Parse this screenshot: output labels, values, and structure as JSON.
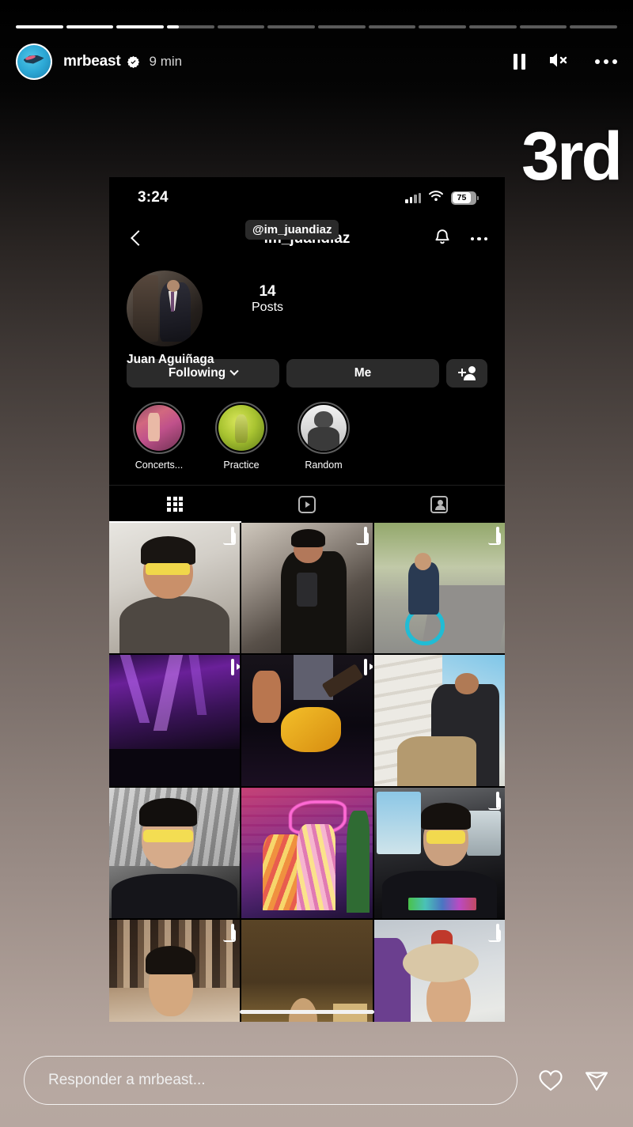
{
  "story": {
    "progress": {
      "total_segments": 12,
      "completed": 3,
      "current_fill_percent": 25
    },
    "header": {
      "username": "mrbeast",
      "verified_icon": "verified-badge-icon",
      "timestamp": "9 min",
      "pause_icon": "pause-icon",
      "mute_icon": "speaker-muted-icon",
      "more_icon": "more-options-icon"
    },
    "reply": {
      "placeholder": "Responder a mrbeast...",
      "like_icon": "heart-icon",
      "send_icon": "paper-plane-icon"
    }
  },
  "phone": {
    "status_bar": {
      "time": "3:24",
      "signal_icon": "cellular-signal-icon",
      "wifi_icon": "wifi-icon",
      "battery_level": "75"
    },
    "nav": {
      "back_icon": "back-chevron-icon",
      "title": "im_juandiaz",
      "notify_icon": "bell-icon",
      "more_icon": "more-options-icon"
    },
    "profile": {
      "display_name": "Juan Aguiñaga",
      "posts_count": "14",
      "posts_label": "Posts",
      "avatar_icon": "profile-avatar"
    },
    "buttons": {
      "following": "Following",
      "chevron_icon": "chevron-down-icon",
      "message": "Me",
      "add_user_icon": "add-person-icon"
    },
    "highlights": [
      {
        "label": "Concerts...",
        "art": "hl1"
      },
      {
        "label": "Practice",
        "art": "hl2"
      },
      {
        "label": "Random",
        "art": "hl3"
      }
    ],
    "tabs": [
      {
        "name": "grid",
        "icon": "grid-icon",
        "active": true
      },
      {
        "name": "reels",
        "icon": "reels-icon",
        "active": false
      },
      {
        "name": "tagged",
        "icon": "tagged-icon",
        "active": false
      }
    ],
    "grid": [
      {
        "art": "p-selfie1",
        "badge": "carousel"
      },
      {
        "art": "p-mirror",
        "badge": "carousel"
      },
      {
        "art": "p-bike",
        "badge": "carousel"
      },
      {
        "art": "p-concert",
        "badge": "reel"
      },
      {
        "art": "p-guitar",
        "badge": "reel"
      },
      {
        "art": "p-stairs",
        "badge": "none"
      },
      {
        "art": "p-selfie2",
        "badge": "none"
      },
      {
        "art": "p-neon",
        "badge": "none"
      },
      {
        "art": "p-car",
        "badge": "carousel"
      },
      {
        "art": "p-party",
        "badge": "carousel"
      },
      {
        "art": "p-brown",
        "badge": "none"
      },
      {
        "art": "p-hat",
        "badge": "carousel"
      }
    ]
  },
  "stickers": {
    "rank_text": "3rd",
    "mention_text": "@im_juandiaz"
  }
}
